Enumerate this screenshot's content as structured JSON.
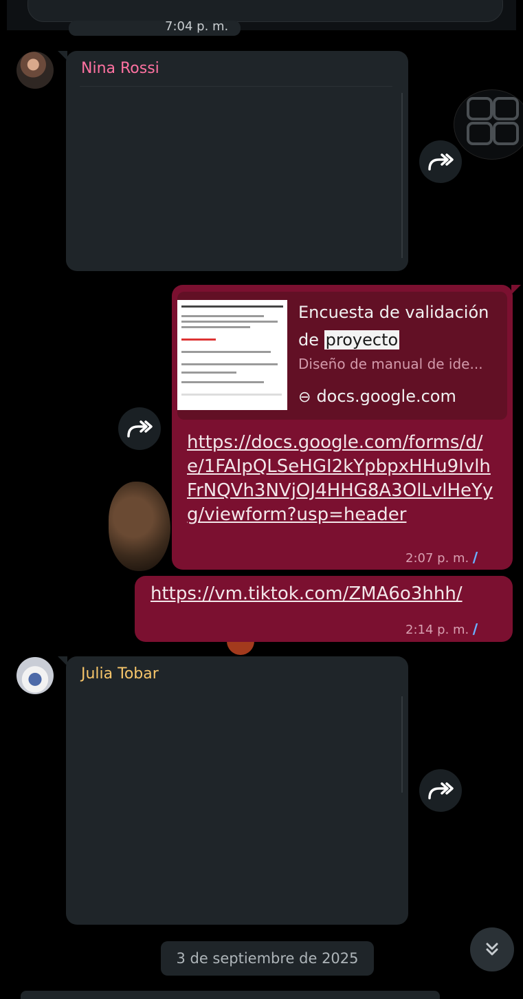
{
  "chat": {
    "previous_time": "7:04 p. m.",
    "messages": [
      {
        "sender": "Nina Rossi",
        "sender_color": "#ff72a1"
      },
      {
        "preview": {
          "title_before": "Encuesta de validación de ",
          "title_highlight": "proyecto",
          "description": "Diseño de manual de ide...",
          "domain": "docs.google.com"
        },
        "link": "https://docs.google.com/forms/d/e/1FAIpQLSeHGI2kYpbpxHHu9IvlhFrNQVh3NVjOJ4HHG8A3OlLvlHeYyg/viewform?usp=header",
        "time": "2:07 p. m."
      },
      {
        "link": "https://vm.tiktok.com/ZMA6o3hhh/",
        "time": "2:14 p. m."
      },
      {
        "sender": "Julia Tobar",
        "sender_color": "#f6c56a"
      }
    ],
    "date_separator": "3 de septiembre de 2025"
  },
  "icons": {
    "forward": "forward-icon",
    "link": "link-icon",
    "read_receipt": "double-check-icon",
    "scroll_down": "double-chevron-down-icon",
    "grid": "grid-icon"
  },
  "colors": {
    "outgoing_bubble": "#7b1030",
    "incoming_bubble": "#1f2529",
    "read_ticks": "#6ab0ff"
  }
}
